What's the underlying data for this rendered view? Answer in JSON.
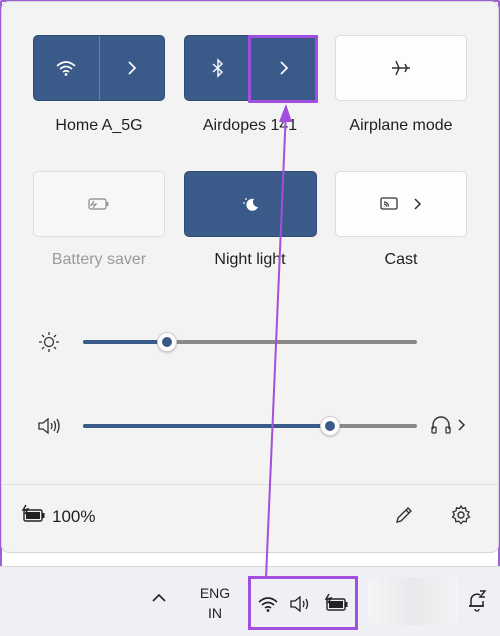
{
  "tiles": {
    "wifi": {
      "label": "Home A_5G",
      "icon": "wifi-icon",
      "state": "on"
    },
    "bluetooth": {
      "label": "Airdopes 141",
      "icon": "bluetooth-icon",
      "state": "on"
    },
    "airplane": {
      "label": "Airplane mode",
      "icon": "airplane-icon",
      "state": "off"
    },
    "battery_saver": {
      "label": "Battery saver",
      "icon": "battery-saver-icon",
      "state": "disabled"
    },
    "night_light": {
      "label": "Night light",
      "icon": "night-light-icon",
      "state": "on"
    },
    "cast": {
      "label": "Cast",
      "icon": "cast-icon",
      "state": "off"
    }
  },
  "sliders": {
    "brightness": {
      "icon": "sun-icon",
      "value": 0.25
    },
    "volume": {
      "icon": "speaker-icon",
      "value": 0.74,
      "output_icon": "headphones-icon"
    }
  },
  "footer": {
    "battery_percent": "100%",
    "battery_icon": "battery-charging-icon",
    "edit_icon": "pencil-icon",
    "settings_icon": "gear-icon"
  },
  "taskbar": {
    "overflow_icon": "chevron-up-icon",
    "language_line1": "ENG",
    "language_line2": "IN",
    "tray_icons": [
      "wifi-icon",
      "speaker-icon",
      "battery-charging-icon"
    ],
    "notification_icon": "bell-snooze-icon"
  },
  "colors": {
    "accent": "#3a5a8a",
    "highlight": "#a24ee0"
  }
}
